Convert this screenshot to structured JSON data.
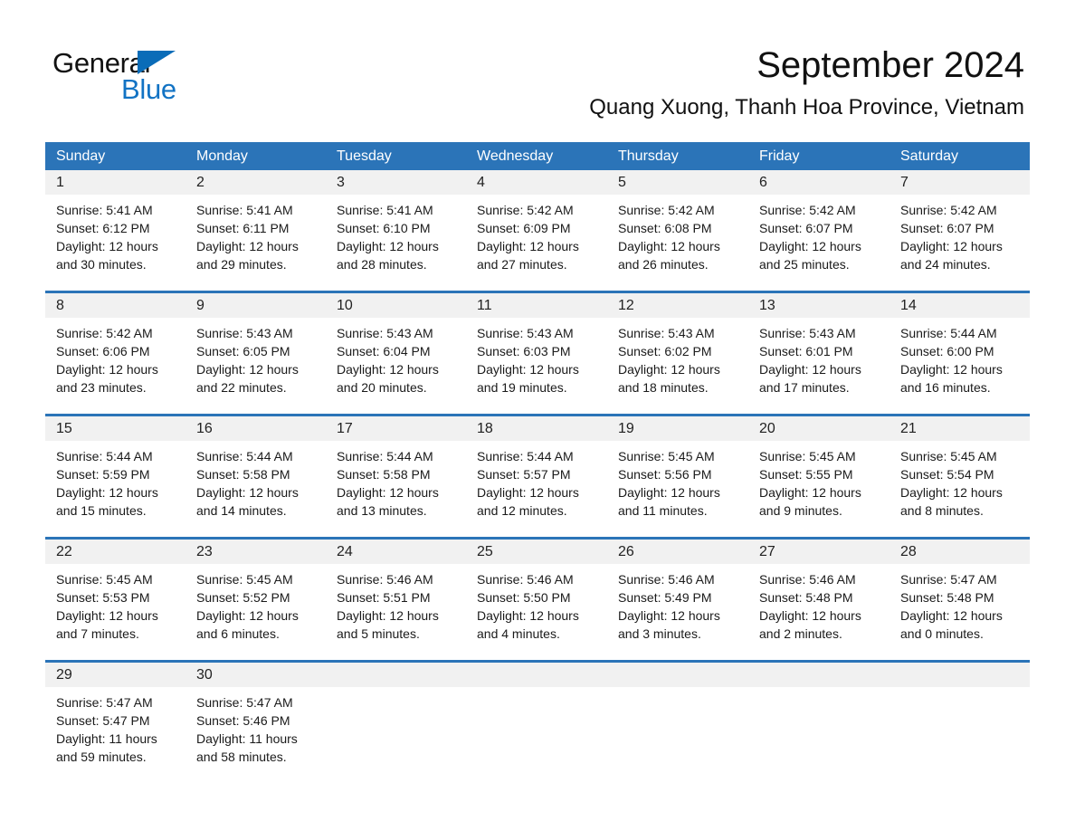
{
  "logo": {
    "word_general": "General",
    "word_blue": "Blue",
    "triangle_color": "#0a6cb8",
    "blue_text_color": "#1273c4",
    "name": "general-blue-logo"
  },
  "header": {
    "month_title": "September 2024",
    "location": "Quang Xuong, Thanh Hoa Province, Vietnam"
  },
  "theme": {
    "header_blue": "#2b74b8",
    "daynum_band": "#f1f1f1",
    "cell_background": "#ffffff",
    "text_color": "#1a1a1a"
  },
  "calendar": {
    "weekday_headers": [
      "Sunday",
      "Monday",
      "Tuesday",
      "Wednesday",
      "Thursday",
      "Friday",
      "Saturday"
    ],
    "weeks": [
      {
        "days": [
          {
            "num": "1",
            "sunrise": "Sunrise: 5:41 AM",
            "sunset": "Sunset: 6:12 PM",
            "daylight1": "Daylight: 12 hours",
            "daylight2": "and 30 minutes."
          },
          {
            "num": "2",
            "sunrise": "Sunrise: 5:41 AM",
            "sunset": "Sunset: 6:11 PM",
            "daylight1": "Daylight: 12 hours",
            "daylight2": "and 29 minutes."
          },
          {
            "num": "3",
            "sunrise": "Sunrise: 5:41 AM",
            "sunset": "Sunset: 6:10 PM",
            "daylight1": "Daylight: 12 hours",
            "daylight2": "and 28 minutes."
          },
          {
            "num": "4",
            "sunrise": "Sunrise: 5:42 AM",
            "sunset": "Sunset: 6:09 PM",
            "daylight1": "Daylight: 12 hours",
            "daylight2": "and 27 minutes."
          },
          {
            "num": "5",
            "sunrise": "Sunrise: 5:42 AM",
            "sunset": "Sunset: 6:08 PM",
            "daylight1": "Daylight: 12 hours",
            "daylight2": "and 26 minutes."
          },
          {
            "num": "6",
            "sunrise": "Sunrise: 5:42 AM",
            "sunset": "Sunset: 6:07 PM",
            "daylight1": "Daylight: 12 hours",
            "daylight2": "and 25 minutes."
          },
          {
            "num": "7",
            "sunrise": "Sunrise: 5:42 AM",
            "sunset": "Sunset: 6:07 PM",
            "daylight1": "Daylight: 12 hours",
            "daylight2": "and 24 minutes."
          }
        ]
      },
      {
        "days": [
          {
            "num": "8",
            "sunrise": "Sunrise: 5:42 AM",
            "sunset": "Sunset: 6:06 PM",
            "daylight1": "Daylight: 12 hours",
            "daylight2": "and 23 minutes."
          },
          {
            "num": "9",
            "sunrise": "Sunrise: 5:43 AM",
            "sunset": "Sunset: 6:05 PM",
            "daylight1": "Daylight: 12 hours",
            "daylight2": "and 22 minutes."
          },
          {
            "num": "10",
            "sunrise": "Sunrise: 5:43 AM",
            "sunset": "Sunset: 6:04 PM",
            "daylight1": "Daylight: 12 hours",
            "daylight2": "and 20 minutes."
          },
          {
            "num": "11",
            "sunrise": "Sunrise: 5:43 AM",
            "sunset": "Sunset: 6:03 PM",
            "daylight1": "Daylight: 12 hours",
            "daylight2": "and 19 minutes."
          },
          {
            "num": "12",
            "sunrise": "Sunrise: 5:43 AM",
            "sunset": "Sunset: 6:02 PM",
            "daylight1": "Daylight: 12 hours",
            "daylight2": "and 18 minutes."
          },
          {
            "num": "13",
            "sunrise": "Sunrise: 5:43 AM",
            "sunset": "Sunset: 6:01 PM",
            "daylight1": "Daylight: 12 hours",
            "daylight2": "and 17 minutes."
          },
          {
            "num": "14",
            "sunrise": "Sunrise: 5:44 AM",
            "sunset": "Sunset: 6:00 PM",
            "daylight1": "Daylight: 12 hours",
            "daylight2": "and 16 minutes."
          }
        ]
      },
      {
        "days": [
          {
            "num": "15",
            "sunrise": "Sunrise: 5:44 AM",
            "sunset": "Sunset: 5:59 PM",
            "daylight1": "Daylight: 12 hours",
            "daylight2": "and 15 minutes."
          },
          {
            "num": "16",
            "sunrise": "Sunrise: 5:44 AM",
            "sunset": "Sunset: 5:58 PM",
            "daylight1": "Daylight: 12 hours",
            "daylight2": "and 14 minutes."
          },
          {
            "num": "17",
            "sunrise": "Sunrise: 5:44 AM",
            "sunset": "Sunset: 5:58 PM",
            "daylight1": "Daylight: 12 hours",
            "daylight2": "and 13 minutes."
          },
          {
            "num": "18",
            "sunrise": "Sunrise: 5:44 AM",
            "sunset": "Sunset: 5:57 PM",
            "daylight1": "Daylight: 12 hours",
            "daylight2": "and 12 minutes."
          },
          {
            "num": "19",
            "sunrise": "Sunrise: 5:45 AM",
            "sunset": "Sunset: 5:56 PM",
            "daylight1": "Daylight: 12 hours",
            "daylight2": "and 11 minutes."
          },
          {
            "num": "20",
            "sunrise": "Sunrise: 5:45 AM",
            "sunset": "Sunset: 5:55 PM",
            "daylight1": "Daylight: 12 hours",
            "daylight2": "and 9 minutes."
          },
          {
            "num": "21",
            "sunrise": "Sunrise: 5:45 AM",
            "sunset": "Sunset: 5:54 PM",
            "daylight1": "Daylight: 12 hours",
            "daylight2": "and 8 minutes."
          }
        ]
      },
      {
        "days": [
          {
            "num": "22",
            "sunrise": "Sunrise: 5:45 AM",
            "sunset": "Sunset: 5:53 PM",
            "daylight1": "Daylight: 12 hours",
            "daylight2": "and 7 minutes."
          },
          {
            "num": "23",
            "sunrise": "Sunrise: 5:45 AM",
            "sunset": "Sunset: 5:52 PM",
            "daylight1": "Daylight: 12 hours",
            "daylight2": "and 6 minutes."
          },
          {
            "num": "24",
            "sunrise": "Sunrise: 5:46 AM",
            "sunset": "Sunset: 5:51 PM",
            "daylight1": "Daylight: 12 hours",
            "daylight2": "and 5 minutes."
          },
          {
            "num": "25",
            "sunrise": "Sunrise: 5:46 AM",
            "sunset": "Sunset: 5:50 PM",
            "daylight1": "Daylight: 12 hours",
            "daylight2": "and 4 minutes."
          },
          {
            "num": "26",
            "sunrise": "Sunrise: 5:46 AM",
            "sunset": "Sunset: 5:49 PM",
            "daylight1": "Daylight: 12 hours",
            "daylight2": "and 3 minutes."
          },
          {
            "num": "27",
            "sunrise": "Sunrise: 5:46 AM",
            "sunset": "Sunset: 5:48 PM",
            "daylight1": "Daylight: 12 hours",
            "daylight2": "and 2 minutes."
          },
          {
            "num": "28",
            "sunrise": "Sunrise: 5:47 AM",
            "sunset": "Sunset: 5:48 PM",
            "daylight1": "Daylight: 12 hours",
            "daylight2": "and 0 minutes."
          }
        ]
      },
      {
        "days": [
          {
            "num": "29",
            "sunrise": "Sunrise: 5:47 AM",
            "sunset": "Sunset: 5:47 PM",
            "daylight1": "Daylight: 11 hours",
            "daylight2": "and 59 minutes."
          },
          {
            "num": "30",
            "sunrise": "Sunrise: 5:47 AM",
            "sunset": "Sunset: 5:46 PM",
            "daylight1": "Daylight: 11 hours",
            "daylight2": "and 58 minutes."
          },
          {
            "num": "",
            "sunrise": "",
            "sunset": "",
            "daylight1": "",
            "daylight2": ""
          },
          {
            "num": "",
            "sunrise": "",
            "sunset": "",
            "daylight1": "",
            "daylight2": ""
          },
          {
            "num": "",
            "sunrise": "",
            "sunset": "",
            "daylight1": "",
            "daylight2": ""
          },
          {
            "num": "",
            "sunrise": "",
            "sunset": "",
            "daylight1": "",
            "daylight2": ""
          },
          {
            "num": "",
            "sunrise": "",
            "sunset": "",
            "daylight1": "",
            "daylight2": ""
          }
        ]
      }
    ]
  }
}
